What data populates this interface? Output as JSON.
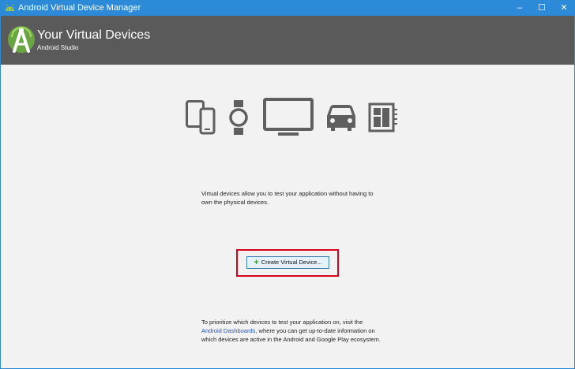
{
  "window": {
    "title": "Android Virtual Device Manager",
    "controls": {
      "minimize": "–",
      "maximize": "☐",
      "close": "✕"
    }
  },
  "header": {
    "title": "Your Virtual Devices",
    "subtitle": "Android Studio",
    "logo_icon": "android-studio-logo-icon",
    "background": "#5a5a5a"
  },
  "device_icons": [
    "phone-tablet-icon",
    "wear-watch-icon",
    "tv-icon",
    "car-icon",
    "things-board-icon"
  ],
  "main": {
    "intro": "Virtual devices allow you to test your application without having to own the physical devices.",
    "create_button": "Create Virtual Device...",
    "create_icon": "plus-icon",
    "footer_before": "To prioritize which devices to test your application on, visit the",
    "footer_link": "Android Dashboards",
    "footer_after": ", where you can get up-to-date information on which devices are active in the Android and Google Play ecosystem."
  },
  "colors": {
    "titlebar": "#2d8ad8",
    "highlight_box": "#d9001b",
    "link": "#1a55c8",
    "icon_gray": "#5f5f5f"
  }
}
